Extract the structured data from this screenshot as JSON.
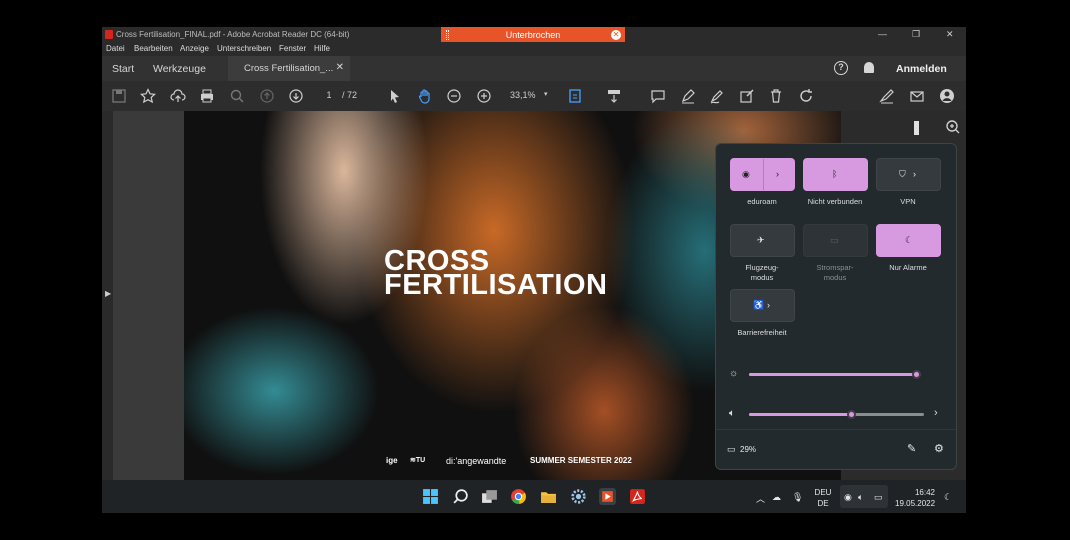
{
  "window": {
    "title": "Cross Fertilisation_FINAL.pdf - Adobe Acrobat Reader DC (64-bit)",
    "minimize": "—",
    "restore": "❐",
    "close": "✕"
  },
  "recording_bar": {
    "label": "Unterbrochen",
    "close": "✕"
  },
  "menu": [
    "Datei",
    "Bearbeiten",
    "Anzeige",
    "Unterschreiben",
    "Fenster",
    "Hilfe"
  ],
  "tabs": {
    "home": "Start",
    "tools": "Werkzeuge",
    "document": "Cross Fertilisation_...",
    "close": "✕"
  },
  "account": {
    "help": "?",
    "login": "Anmelden"
  },
  "toolbar": {
    "page_current": "1",
    "page_total": "/ 72",
    "zoom": "33,1%",
    "zoom_caret": "▾"
  },
  "document": {
    "heading_line1": "CROSS",
    "heading_line2": "FERTILISATION",
    "footer_logo1": "ige",
    "footer_logo3": "di:'angewandte",
    "footer_text": "SUMMER SEMESTER 2022"
  },
  "quick_settings": {
    "tiles": [
      {
        "label": "eduroam",
        "state": "on",
        "icon": "wifi-icon"
      },
      {
        "label": "Nicht verbunden",
        "state": "on",
        "icon": "bluetooth-icon"
      },
      {
        "label": "VPN",
        "state": "off",
        "icon": "shield-icon"
      },
      {
        "label": "Flugzeug-\nmodus",
        "state": "off",
        "icon": "airplane-icon"
      },
      {
        "label": "Stromspar-\nmodus",
        "state": "disabled",
        "icon": "battery-saver-icon"
      },
      {
        "label": "Nur Alarme",
        "state": "on",
        "icon": "moon-icon"
      },
      {
        "label": "Barrierefreiheit",
        "state": "off",
        "icon": "accessibility-icon"
      }
    ],
    "brightness": 0.97,
    "volume": 0.58,
    "battery": "29%",
    "accent": "#d79ae0"
  },
  "taskbar": {
    "lang_line1": "DEU",
    "lang_line2": "DE",
    "time": "16:42",
    "date": "19.05.2022"
  }
}
